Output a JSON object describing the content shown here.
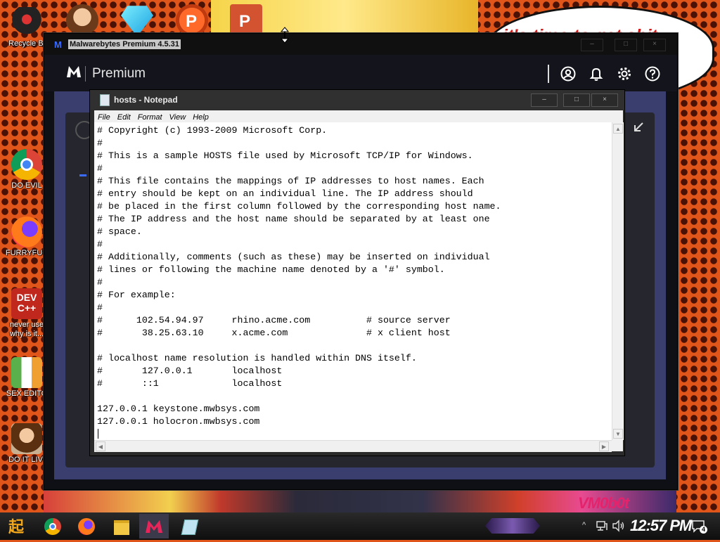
{
  "desktop": {
    "icons": [
      {
        "label": "Recycle Bi"
      },
      {
        "label": "DO EVIL"
      },
      {
        "label": "FURRYFUC"
      },
      {
        "label": "never use\nwhy is it..."
      },
      {
        "label": "SEX EDITO"
      },
      {
        "label": "DO IT LIVI"
      }
    ],
    "devcpp_text": "DEV\nC++",
    "speech_bubble": "it's time to get shit",
    "watermark": "VM0b0t"
  },
  "malwarebytes": {
    "window_title": "Malwarebytes Premium  4.5.31",
    "app_name": "Premium",
    "header_icons": [
      "account-icon",
      "bell-icon",
      "gear-icon",
      "help-icon"
    ]
  },
  "notepad": {
    "window_title": "hosts - Notepad",
    "menu": [
      "File",
      "Edit",
      "Format",
      "View",
      "Help"
    ],
    "content": "# Copyright (c) 1993-2009 Microsoft Corp.\n#\n# This is a sample HOSTS file used by Microsoft TCP/IP for Windows.\n#\n# This file contains the mappings of IP addresses to host names. Each\n# entry should be kept on an individual line. The IP address should\n# be placed in the first column followed by the corresponding host name.\n# The IP address and the host name should be separated by at least one\n# space.\n#\n# Additionally, comments (such as these) may be inserted on individual\n# lines or following the machine name denoted by a '#' symbol.\n#\n# For example:\n#\n#      102.54.94.97     rhino.acme.com          # source server\n#       38.25.63.10     x.acme.com              # x client host\n\n# localhost name resolution is handled within DNS itself.\n#\t127.0.0.1       localhost\n#\t::1             localhost\n\n127.0.0.1 keystone.mwbsys.com\n127.0.0.1 holocron.mwbsys.com\n"
  },
  "taskbar": {
    "clock": "12:57 PM",
    "notification_count": "4",
    "pinned": [
      "start-button",
      "chrome-icon",
      "firefox-icon",
      "file-explorer-icon",
      "malwarebytes-icon",
      "notepad-icon"
    ]
  }
}
